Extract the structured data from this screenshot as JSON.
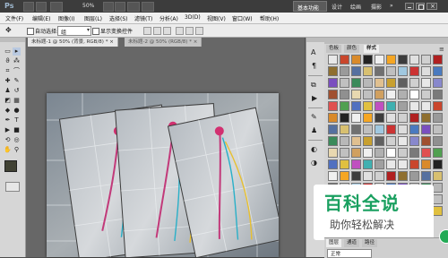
{
  "app": {
    "logo": "Ps",
    "zoom_value": "50%",
    "workspaces": [
      "基本功能",
      "设计",
      "绘画",
      "摄影"
    ],
    "more": "»"
  },
  "menu": [
    "文件(F)",
    "编辑(E)",
    "图像(I)",
    "图层(L)",
    "选择(S)",
    "滤镜(T)",
    "分析(A)",
    "3D(D)",
    "视图(V)",
    "窗口(W)",
    "帮助(H)"
  ],
  "options": {
    "auto_select_label": "自动选择:",
    "auto_select_value": "组",
    "show_transform_label": "显示变换控件"
  },
  "documents": {
    "tabs": [
      "未标题-1 @ 50% (背景, RGB/8) * ×",
      "未标题-2 @ 50% (RGB/8) * ×"
    ]
  },
  "panels": {
    "tabs": [
      "色板",
      "颜色",
      "样式"
    ],
    "bottom_tabs": [
      "图层",
      "通道",
      "路径"
    ],
    "bottom_mode": "正常"
  },
  "watermark": {
    "title": "百科全说",
    "subtitle": "助你轻松解决"
  },
  "colors": {
    "appbar": "#3c3c3c",
    "menubar": "#f0f0f0",
    "workspace_active": "#5b5b5b",
    "watermark_text": "#1aa060",
    "watermark_sub": "#4a4a4a"
  }
}
